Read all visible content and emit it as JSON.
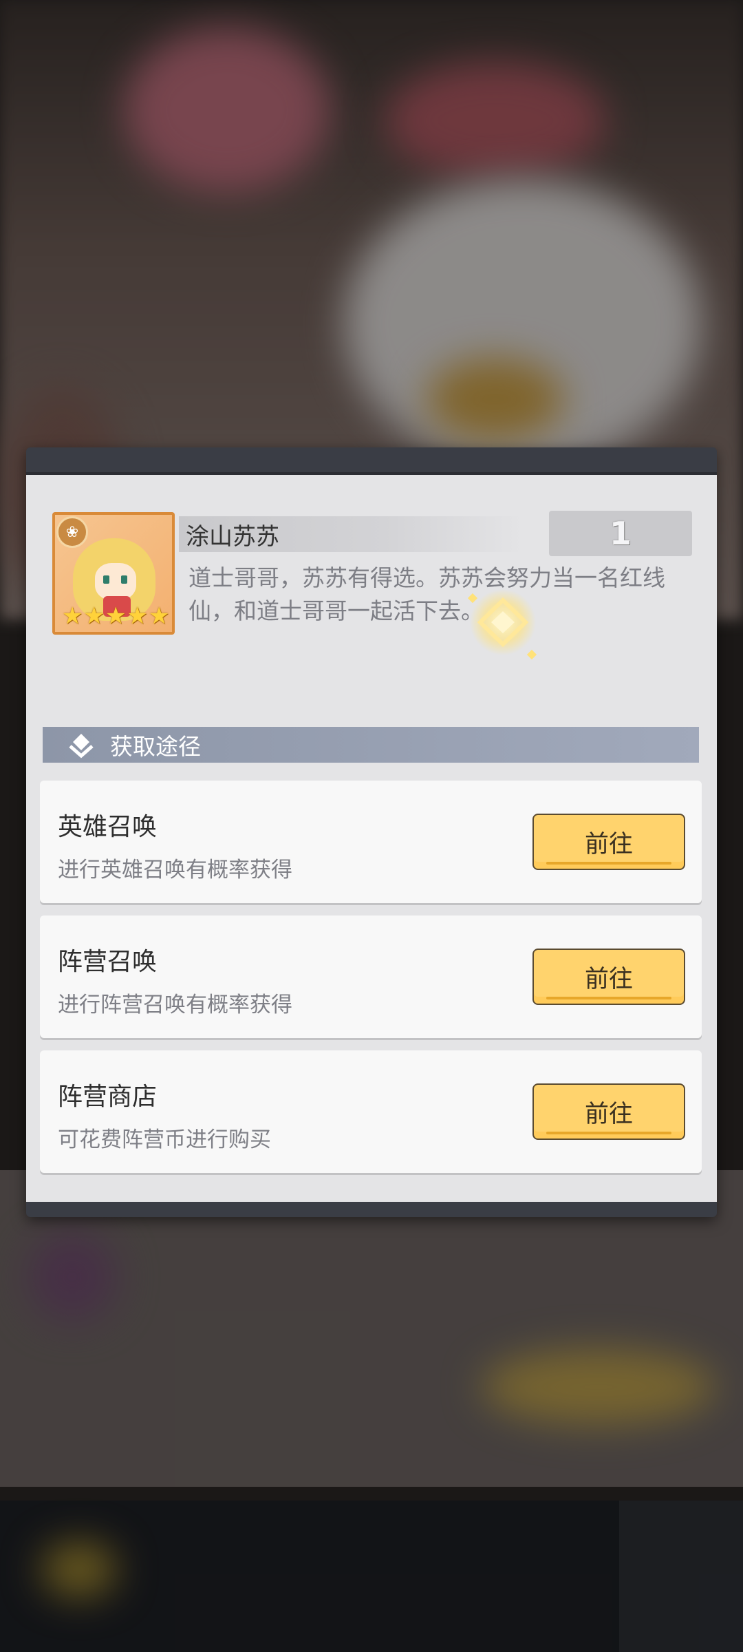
{
  "hero": {
    "name": "涂山苏苏",
    "count": "1",
    "description": "道士哥哥，苏苏有得选。苏苏会努力当一名红线仙，和道士哥哥一起活下去。",
    "stars": 5
  },
  "section": {
    "title": "获取途径"
  },
  "sources": [
    {
      "title": "英雄召唤",
      "subtitle": "进行英雄召唤有概率获得",
      "button": "前往"
    },
    {
      "title": "阵营召唤",
      "subtitle": "进行阵营召唤有概率获得",
      "button": "前往"
    },
    {
      "title": "阵营商店",
      "subtitle": "可花费阵营币进行购买",
      "button": "前往"
    }
  ],
  "colors": {
    "button": "#ffd36d",
    "section_header": "#9aa2b4",
    "dialog_bg": "#e4e4e6"
  }
}
